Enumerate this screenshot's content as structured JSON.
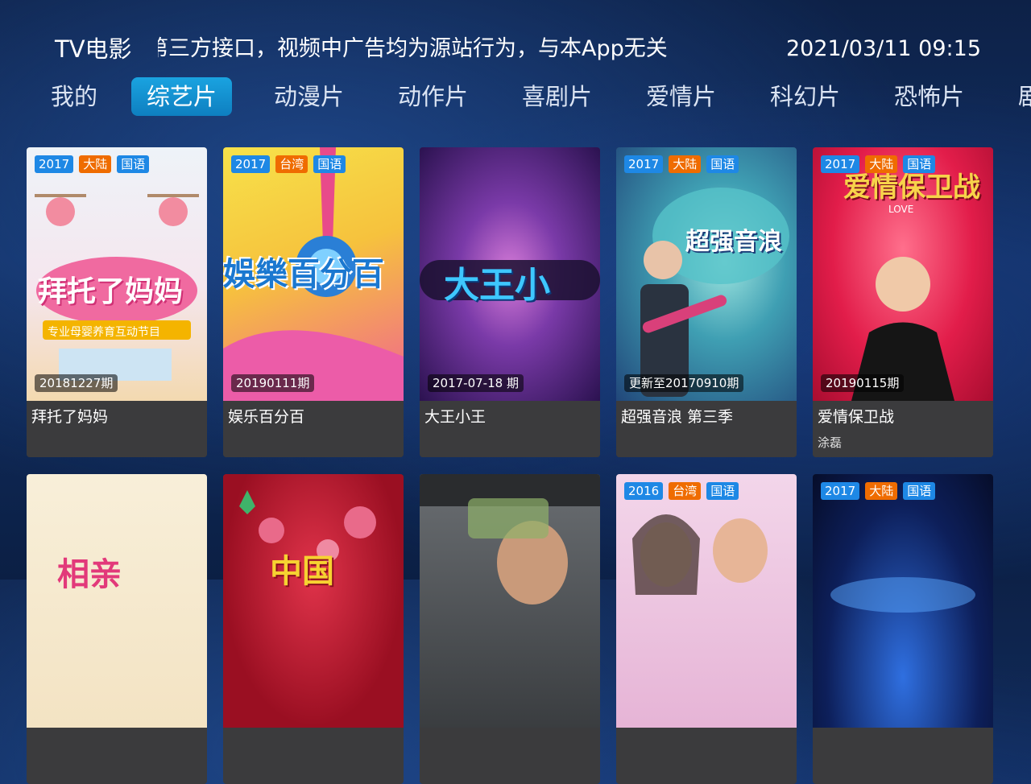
{
  "header": {
    "app_title": "TV电影",
    "notice": "第三方接口，视频中广告均为源站行为，与本App无关",
    "datetime": "2021/03/11 09:15"
  },
  "tabs": [
    {
      "label": "我的"
    },
    {
      "label": "综艺片",
      "active": true
    },
    {
      "label": "动漫片"
    },
    {
      "label": "动作片"
    },
    {
      "label": "喜剧片"
    },
    {
      "label": "爱情片"
    },
    {
      "label": "科幻片"
    },
    {
      "label": "恐怖片"
    },
    {
      "label": "剧"
    }
  ],
  "cards_row1": [
    {
      "year": "2017",
      "region": "大陆",
      "lang": "国语",
      "episode": "20181227期",
      "title": "拜托了妈妈",
      "subtitle": "",
      "poster_text": "拜托了妈妈",
      "poster_caption": "专业母婴养育互动节目"
    },
    {
      "year": "2017",
      "region": "台湾",
      "lang": "国语",
      "episode": "20190111期",
      "title": "娱乐百分百",
      "subtitle": "",
      "poster_text": "娛樂百分百"
    },
    {
      "year": "",
      "region": "",
      "lang": "",
      "episode": "2017-07-18 期",
      "title": "大王小王",
      "subtitle": "",
      "poster_text": "大王小"
    },
    {
      "year": "2017",
      "region": "大陆",
      "lang": "国语",
      "episode": "更新至20170910期",
      "title": "超强音浪 第三季",
      "subtitle": "",
      "poster_text": "超强音浪"
    },
    {
      "year": "2017",
      "region": "大陆",
      "lang": "国语",
      "episode": "20190115期",
      "title": "爱情保卫战",
      "subtitle": "涂磊",
      "poster_text": "爱情保卫战",
      "poster_small": "LOVE"
    }
  ],
  "cards_row2": [
    {
      "year": "",
      "region": "",
      "lang": "",
      "poster_text": "相亲"
    },
    {
      "year": "",
      "region": "",
      "lang": "",
      "poster_text": "中国"
    },
    {
      "year": "",
      "region": "",
      "lang": "",
      "poster_text": ""
    },
    {
      "year": "2016",
      "region": "台湾",
      "lang": "国语",
      "poster_text": ""
    },
    {
      "year": "2017",
      "region": "大陆",
      "lang": "国语",
      "poster_text": ""
    }
  ],
  "colors": {
    "active_tab": "#1598d6",
    "badge_blue": "#1e88e5",
    "badge_orange": "#ef6c00",
    "card_info_bg": "#3b3b3d"
  }
}
